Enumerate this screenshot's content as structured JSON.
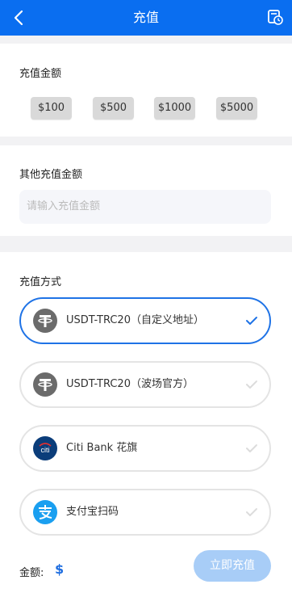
{
  "header": {
    "title": "充值"
  },
  "amount_section": {
    "label": "充值金额",
    "options": [
      "$100",
      "$500",
      "$1000",
      "$5000"
    ]
  },
  "other_section": {
    "label": "其他充值金额",
    "input_placeholder": "请输入充值金额"
  },
  "method_section": {
    "label": "充值方式",
    "methods": [
      {
        "label": "USDT-TRC20（自定义地址）",
        "icon": "tether-icon",
        "selected": true
      },
      {
        "label": "USDT-TRC20（波场官方）",
        "icon": "tether-icon",
        "selected": false
      },
      {
        "label": "Citi Bank 花旗",
        "icon": "citi-icon",
        "selected": false
      },
      {
        "label": "支付宝扫码",
        "icon": "alipay-icon",
        "selected": false
      }
    ]
  },
  "footer": {
    "amount_label": "金额:",
    "currency": "$",
    "submit_label": "立即充值"
  },
  "colors": {
    "primary": "#0a6ef0",
    "selected_border": "#1f73e6",
    "submit_bg": "#a8cdf7"
  }
}
